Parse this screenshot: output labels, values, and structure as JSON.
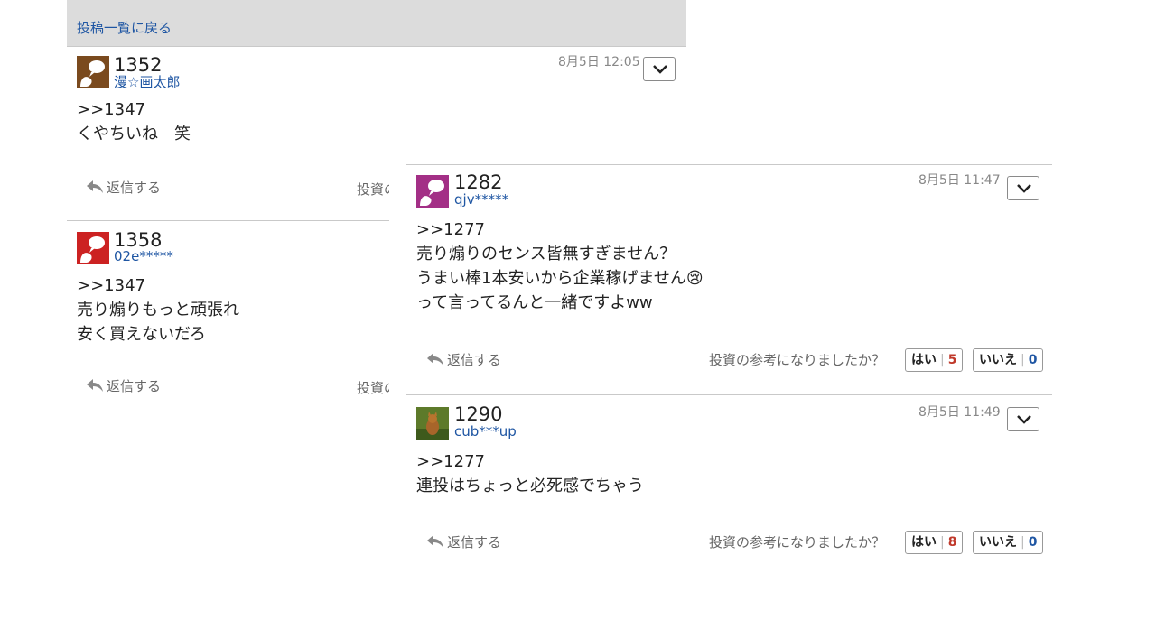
{
  "back_link": "投稿一覧に戻る",
  "reply_label": "返信する",
  "feedback_question": "投資の参考になりましたか？",
  "feedback_question_clipped": "投資の",
  "yes_label": "はい",
  "no_label": "いいえ",
  "posts": [
    {
      "number": "1352",
      "user": "漫☆画太郎",
      "date": "8月5日 12:05",
      "lines": [
        ">>1347",
        "くやちいね　笑"
      ],
      "avatar_color": "#7a4a1e"
    },
    {
      "number": "1358",
      "user": "02e*****",
      "lines": [
        ">>1347",
        "売り煽りもっと頑張れ",
        "安く買えないだろ"
      ],
      "avatar_color": "#cc2222"
    },
    {
      "number": "1282",
      "user": "qjv*****",
      "date": "8月5日 11:47",
      "lines": [
        ">>1277",
        "売り煽りのセンス皆無すぎません？",
        "うまい棒1本安いから企業稼げません😢",
        "って言ってるんと一緒ですよww"
      ],
      "yes_count": "5",
      "no_count": "0",
      "avatar_color": "#a32f86"
    },
    {
      "number": "1290",
      "user": "cub***up",
      "date": "8月5日 11:49",
      "lines": [
        ">>1277",
        "連投はちょっと必死感でちゃう"
      ],
      "yes_count": "8",
      "no_count": "0",
      "avatar_color": "#5d7a2a"
    }
  ]
}
